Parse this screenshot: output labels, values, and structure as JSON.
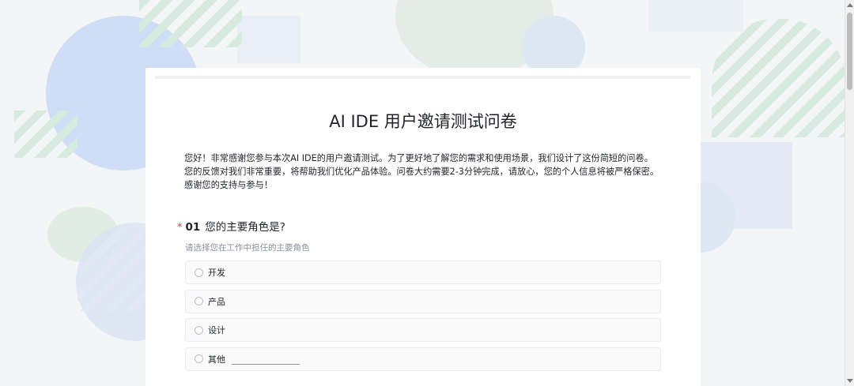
{
  "survey": {
    "title": "AI IDE 用户邀请测试问卷",
    "intro": [
      "您好！非常感谢您参与本次AI IDE的用户邀请测试。为了更好地了解您的需求和使用场景，我们设计了这份简短的问卷。",
      "您的反馈对我们非常重要，将帮助我们优化产品体验。问卷大约需要2-3分钟完成，请放心，您的个人信息将被严格保密。",
      "感谢您的支持与参与！"
    ]
  },
  "question1": {
    "required_mark": "*",
    "number": "01",
    "title": "您的主要角色是?",
    "hint": "请选择您在工作中担任的主要角色",
    "options": [
      "开发",
      "产品",
      "设计",
      "其他"
    ],
    "other_value": ""
  },
  "colors": {
    "required": "#e23b3b",
    "card_bg": "#ffffff",
    "option_border": "#ebedf0"
  }
}
